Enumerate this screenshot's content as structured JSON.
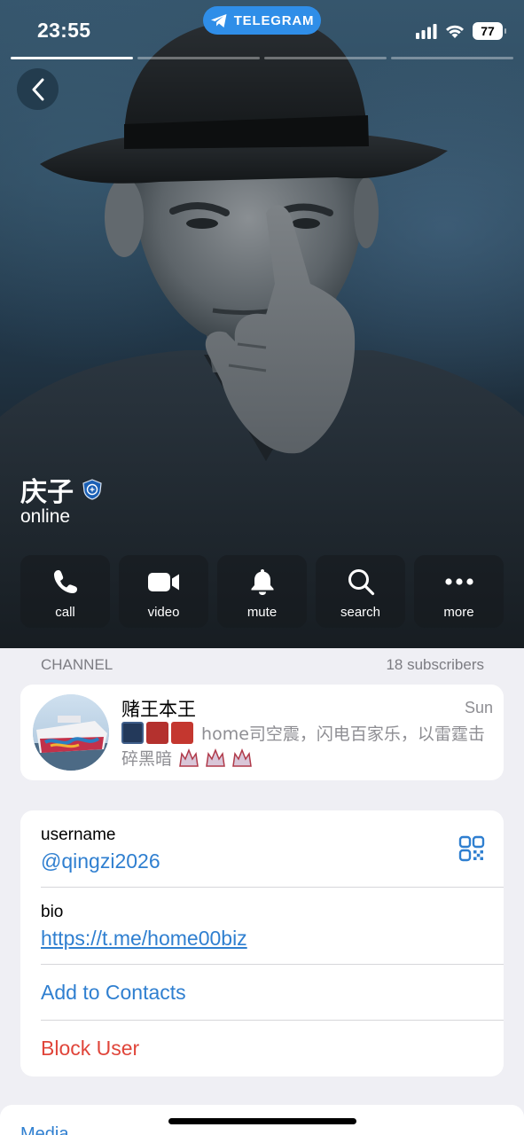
{
  "status_bar": {
    "time": "23:55",
    "app_pill": "TELEGRAM",
    "battery": "77",
    "icons": [
      "signal-icon",
      "wifi-icon",
      "battery-icon"
    ]
  },
  "profile": {
    "name": "庆子",
    "status": "online",
    "badge_icon": "chelsea-badge-icon"
  },
  "actions": [
    {
      "label": "call",
      "icon": "phone-icon"
    },
    {
      "label": "video",
      "icon": "video-camera-icon"
    },
    {
      "label": "mute",
      "icon": "bell-icon"
    },
    {
      "label": "search",
      "icon": "search-icon"
    },
    {
      "label": "more",
      "icon": "more-dots-icon"
    }
  ],
  "channel_section": {
    "header": "CHANNEL",
    "subscribers": "18 subscribers",
    "channel": {
      "title": "赌王本王",
      "date": "Sun",
      "preview_text": "home司空震，闪电百家乐，以雷霆击碎黑暗"
    }
  },
  "info": {
    "username_label": "username",
    "username_value": "@qingzi2026",
    "bio_label": "bio",
    "bio_value": "https://t.me/home00biz",
    "add_contacts": "Add to Contacts",
    "block_user": "Block User"
  },
  "bottom_peek_label": "Media",
  "colors": {
    "accent": "#2f7fd0",
    "destructive": "#e0453a",
    "telegram_pill": "#2f8ee8",
    "background": "#efeff4"
  }
}
